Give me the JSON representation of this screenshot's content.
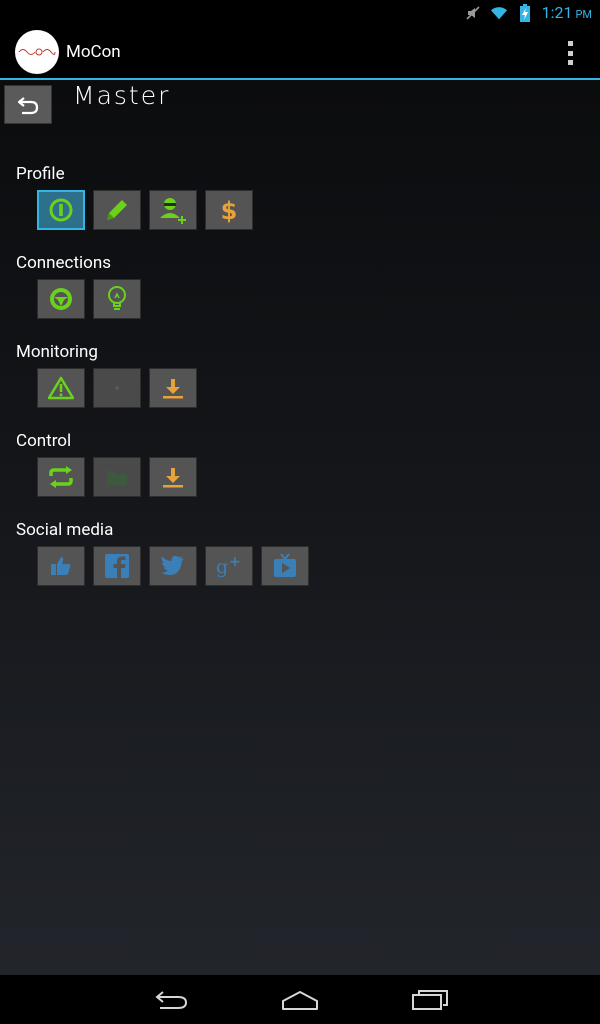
{
  "status_bar": {
    "time": "1:21",
    "ampm": "PM",
    "icons": [
      "mute-icon",
      "wifi-icon",
      "battery-charging-icon"
    ]
  },
  "action_bar": {
    "app_name": "MoCon",
    "logo_icon": "mocon-logo-icon",
    "overflow_icon": "overflow-menu-icon"
  },
  "page": {
    "title": "Master",
    "back_icon": "back-arrow-icon"
  },
  "sections": [
    {
      "label": "Profile",
      "buttons": [
        "power-icon",
        "pencil-icon",
        "add-user-icon",
        "dollar-icon"
      ]
    },
    {
      "label": "Connections",
      "buttons": [
        "steering-wheel-icon",
        "lightbulb-icon"
      ]
    },
    {
      "label": "Monitoring",
      "buttons": [
        "warning-icon",
        "placeholder-icon",
        "download-icon"
      ]
    },
    {
      "label": "Control",
      "buttons": [
        "sync-icon",
        "folder-icon",
        "download-icon"
      ]
    },
    {
      "label": "Social media",
      "buttons": [
        "thumbs-up-icon",
        "facebook-icon",
        "twitter-icon",
        "google-plus-icon",
        "youtube-tv-icon"
      ]
    }
  ],
  "colors": {
    "accent": "#33b5e5",
    "green": "#6bd21b",
    "orange": "#e8a23a",
    "social": "#3a7fb8",
    "tile": "#545454"
  },
  "nav_bar": {
    "icons": [
      "nav-back-icon",
      "nav-home-icon",
      "nav-recents-icon"
    ]
  }
}
